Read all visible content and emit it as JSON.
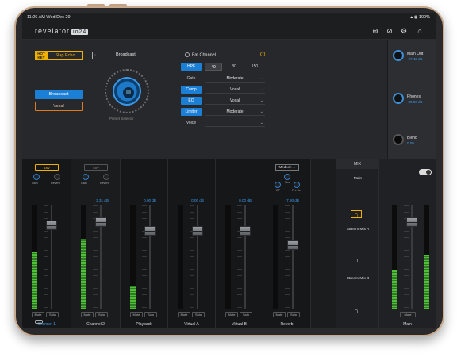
{
  "status": {
    "time_date": "11:26 AM   Wed Dec 29",
    "right": "▴ ◉ 100%"
  },
  "header": {
    "brand": "revelator",
    "model": "io24"
  },
  "presets": {
    "hotkey_label": "HOT KEY",
    "hotkey_preset": "Slap Echo",
    "list": [
      "Broadcast",
      "Vocal"
    ],
    "current": "Broadcast",
    "selector_label": "Preset Selector"
  },
  "fat_channel": {
    "title": "Fat Channel",
    "hpf": {
      "label": "HPF",
      "options": [
        "40",
        "80",
        "150"
      ],
      "selected": "40"
    },
    "rows": [
      {
        "label": "Gate",
        "value": "Moderate",
        "active": false
      },
      {
        "label": "Comp",
        "value": "Vocal",
        "active": true
      },
      {
        "label": "EQ",
        "value": "Vocal",
        "active": true
      },
      {
        "label": "Limiter",
        "value": "Moderate",
        "active": true
      },
      {
        "label": "Voice",
        "value": "",
        "active": false
      }
    ]
  },
  "outputs": [
    {
      "label": "Main Out",
      "value": "-27.42 dB"
    },
    {
      "label": "Phones",
      "value": "-30.00 dB"
    },
    {
      "label": "Blend",
      "value": "0.00"
    }
  ],
  "channels": [
    {
      "name": "Channel 1",
      "phantom": "48V",
      "phantom_on": true,
      "gain_label": "Gain",
      "reverb_label": "Reverb",
      "db": "",
      "meter": 0.55,
      "fader": 0.15,
      "active": true
    },
    {
      "name": "Channel 2",
      "phantom": "48V",
      "phantom_on": false,
      "gain_label": "Gain",
      "reverb_label": "Reverb",
      "db": "3.31 dB",
      "meter": 0.68,
      "fader": 0.12,
      "active": false
    },
    {
      "name": "Playback",
      "db": "0.00 dB",
      "meter": 0.22,
      "fader": 0.2
    },
    {
      "name": "Virtual A",
      "db": "0.00 dB",
      "meter": 0.0,
      "fader": 0.2
    },
    {
      "name": "Virtual B",
      "db": "0.00 dB",
      "meter": 0.0,
      "fader": 0.2
    },
    {
      "name": "Reverb",
      "db": "-7.90 dB",
      "meter": 0.0,
      "fader": 0.35,
      "type": "Medium",
      "knobs": [
        "Size",
        "HPF",
        "Pre Del"
      ]
    }
  ],
  "mute_label": "Mute",
  "solo_label": "Solo",
  "mix": {
    "title": "MIX",
    "items": [
      "Main",
      "Stream Mix A",
      "Stream Mix B"
    ],
    "main_name": "Main"
  }
}
